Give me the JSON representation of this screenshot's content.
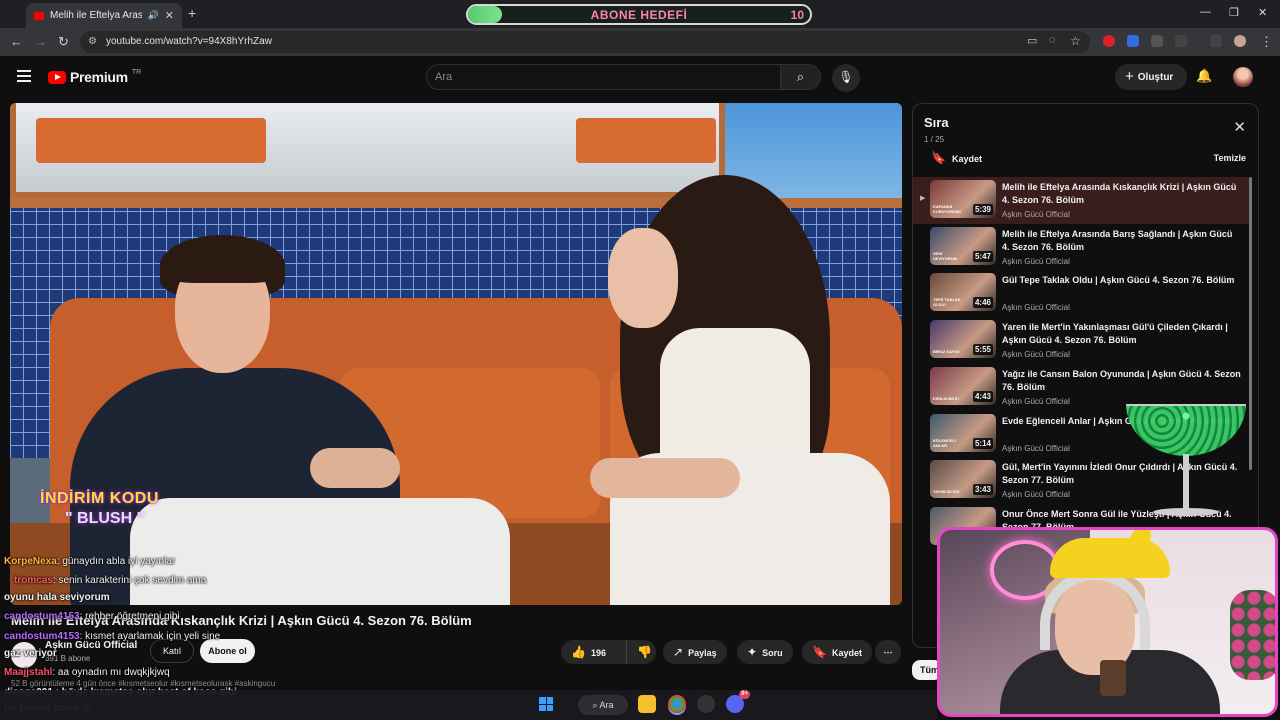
{
  "browser": {
    "tab_title": "Melih ile Eftelya Arasında Kıskanç",
    "new_tab": "+",
    "url": "youtube.com/watch?v=94X8hYrhZaw"
  },
  "goal_widget": {
    "label": "ABONE HEDEFİ",
    "count": "10",
    "progress": 0.1
  },
  "masthead": {
    "logo_text": "Premium",
    "logo_badge": "TR",
    "search_placeholder": "Ara",
    "create_label": "Oluştur"
  },
  "video": {
    "promo_line1": "İNDİRİM KODU",
    "promo_line2": "\" BLUSH \"",
    "title": "Melih ile Eftelya Arasında Kıskançlık Krizi | Aşkın Gücü 4. Sezon 76. Bölüm",
    "channel": "Aşkın Gücü Official",
    "subscribers": "391 B abone",
    "join_label": "Katıl",
    "subscribe_label": "Abone ol",
    "likes": "196",
    "share_label": "Paylaş",
    "ask_label": "Soru",
    "save_label": "Kaydet",
    "description_line": "52 B görüntüleme  4 gün önce  #kısmetseolur #kısmetseolurask #askingucu"
  },
  "chat": [
    {
      "user": "KorpeNexa",
      "color": "#ffb733",
      "text": ": günaydın abla iyi yayınlar"
    },
    {
      "user": "tromcas",
      "color": "#ff5a5a",
      "text": ": senin karakterini çok sevdim ama"
    },
    {
      "user": "",
      "color": "#ffffff",
      "text": "oyunu hala seviyorum"
    },
    {
      "user": "candostum4153",
      "color": "#b56bff",
      "text": ": rehber öğretmeni gibi"
    },
    {
      "user": "candostum4153",
      "color": "#b56bff",
      "text": ": kısmet ayarlamak için yeli sine"
    },
    {
      "user": "",
      "color": "#ffffff",
      "text": "gaz veriyor"
    },
    {
      "user": "Maajjstahl",
      "color": "#ff4f6a",
      "text": ": aa oynadın mı dwqkjkjwq"
    },
    {
      "user": "",
      "color": "#ffffff",
      "text": "dicoqa001 : böyle kısmetse olur best of kaos gibi"
    },
    {
      "user": "",
      "color": "#ffffff",
      "text": "bir format lazım :D"
    }
  ],
  "playlist": {
    "title": "Sıra",
    "position": "1 / 25",
    "save_label": "Kaydet",
    "clear_label": "Temizle",
    "items": [
      {
        "title": "Melih ile Eftelya Arasında Kıskançlık Krizi | Aşkın Gücü 4. Sezon 76. Bölüm",
        "channel": "Aşkın Gücü Official",
        "duration": "5:39",
        "cap": "KAFANDA KURUYORUM!",
        "active": true
      },
      {
        "title": "Melih ile Eftelya Arasında Barış Sağlandı | Aşkın Gücü 4. Sezon 76. Bölüm",
        "channel": "Aşkın Gücü Official",
        "duration": "5:47",
        "cap": "SENİ SEVİYORUM",
        "active": false
      },
      {
        "title": "Gül Tepe Taklak Oldu | Aşkın Gücü 4. Sezon 76. Bölüm",
        "channel": "Aşkın Gücü Official",
        "duration": "4:46",
        "cap": "TEPE TAKLAK OLDU!",
        "active": false
      },
      {
        "title": "Yaren ile Mert'in Yakınlaşması Gül'ü Çileden Çıkardı | Aşkın Gücü 4. Sezon 76. Bölüm",
        "channel": "Aşkın Gücü Official",
        "duration": "5:55",
        "cap": "BİRAZ SAYGI!",
        "active": false
      },
      {
        "title": "Yağız ile Cansın Balon Oyununda | Aşkın Gücü 4. Sezon 76. Bölüm",
        "channel": "Aşkın Gücü Official",
        "duration": "4:43",
        "cap": "KIRILDI BİLE!",
        "active": false
      },
      {
        "title": "Evde Eğlenceli Anlar | Aşkın Gücü 4. Sezon 76. Bölüm",
        "channel": "Aşkın Gücü Official",
        "duration": "5:14",
        "cap": "EĞLENCELİ ANLAR",
        "active": false
      },
      {
        "title": "Gül, Mert'in Yayınını İzledi Onur Çıldırdı | Aşkın Gücü 4. Sezon 77. Bölüm",
        "channel": "Aşkın Gücü Official",
        "duration": "3:43",
        "cap": "YAYINI İZLEDİ",
        "active": false
      },
      {
        "title": "Onur Önce Mert Sonra Gül ile Yüzleşti | Aşkın Gücü 4. Sezon 77. Bölüm",
        "channel": "Aşkın Gücü Official",
        "duration": "",
        "cap": "",
        "active": false
      }
    ]
  },
  "chip_label": "Tüm",
  "taskbar": {
    "search_label": "Ara",
    "discord_badge": "9+"
  }
}
